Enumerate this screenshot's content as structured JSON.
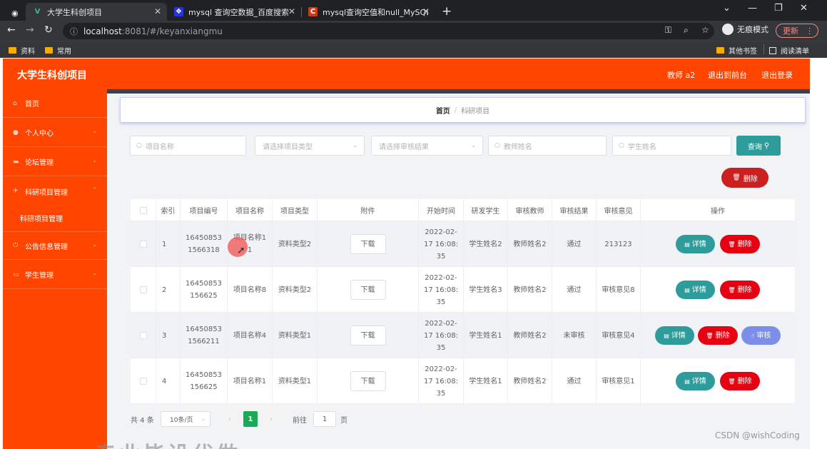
{
  "browser": {
    "tabs": [
      {
        "title": "大学生科创项目"
      },
      {
        "title": "mysql 查询空数据_百度搜索"
      },
      {
        "title": "mysql查询空值和null_MySQL数"
      }
    ],
    "url_host": "localhost",
    "url_rest": ":8081/#/keyanxiangmu",
    "profile": "无痕模式",
    "update": "更新",
    "bookmarks": [
      "资料",
      "常用"
    ],
    "other_bookmarks": "其他书签",
    "reading_list": "阅读清单"
  },
  "header": {
    "title": "大学生科创项目",
    "user": "教师 a2",
    "to_front": "退出到前台",
    "logout": "退出登录"
  },
  "sidebar": {
    "items": [
      {
        "label": "首页"
      },
      {
        "label": "个人中心"
      },
      {
        "label": "论坛管理"
      },
      {
        "label": "科研项目管理"
      },
      {
        "label": "公告信息管理"
      },
      {
        "label": "学生管理"
      }
    ],
    "sub_item": "科研项目管理"
  },
  "breadcrumb": {
    "home": "首页",
    "sep": "/",
    "current": "科研项目"
  },
  "filters": {
    "project_name": "项目名称",
    "project_type": "请选择项目类型",
    "audit_result": "请选择审核结果",
    "teacher_name": "教师姓名",
    "student_name": "学生姓名",
    "query": "查询",
    "batch_delete": "删除"
  },
  "table": {
    "columns": [
      "索引",
      "项目编号",
      "项目名称",
      "项目类型",
      "附件",
      "开始时间",
      "研发学生",
      "审核教师",
      "审核结果",
      "审核意见",
      "操作"
    ],
    "download_label": "下载",
    "detail_label": "详情",
    "delete_label": "删除",
    "audit_label": "审核",
    "rows": [
      {
        "index": "1",
        "code_a": "16450853",
        "code_b": "1566318",
        "name_a": "项目名称1",
        "name_b": "1",
        "type": "资料类型2",
        "date_a": "2022-02-",
        "date_b": "17 16:08:",
        "date_c": "35",
        "student": "学生姓名2",
        "teacher": "教师姓名2",
        "result": "通过",
        "opinion": "213123"
      },
      {
        "index": "2",
        "code_a": "16450853",
        "code_b": "156625",
        "name_a": "项目名称8",
        "name_b": "",
        "type": "资料类型2",
        "date_a": "2022-02-",
        "date_b": "17 16:08:",
        "date_c": "35",
        "student": "学生姓名3",
        "teacher": "教师姓名2",
        "result": "通过",
        "opinion": "审核意见8"
      },
      {
        "index": "3",
        "code_a": "16450853",
        "code_b": "1566211",
        "name_a": "项目名称4",
        "name_b": "",
        "type": "资料类型1",
        "date_a": "2022-02-",
        "date_b": "17 16:08:",
        "date_c": "35",
        "student": "学生姓名1",
        "teacher": "教师姓名2",
        "result": "未审核",
        "opinion": "审核意见4"
      },
      {
        "index": "4",
        "code_a": "16450853",
        "code_b": "156625",
        "name_a": "项目名称1",
        "name_b": "",
        "type": "资料类型1",
        "date_a": "2022-02-",
        "date_b": "17 16:08:",
        "date_c": "35",
        "student": "学生姓名1",
        "teacher": "教师姓名2",
        "result": "通过",
        "opinion": "审核意见1"
      }
    ]
  },
  "pagination": {
    "total": "共 4 条",
    "page_size": "10条/页",
    "current": "1",
    "goto_label": "前往",
    "goto_value": "1",
    "page_unit": "页"
  },
  "watermark": "CSDN @wishCoding",
  "bottom_text": "专业毕设代做"
}
